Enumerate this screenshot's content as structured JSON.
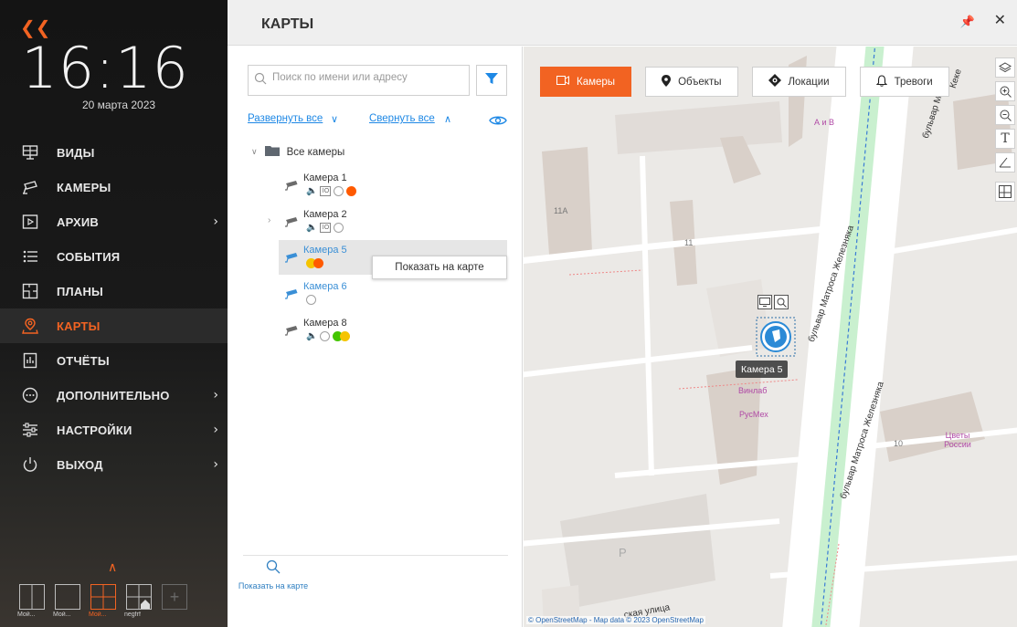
{
  "sidebar": {
    "clock": "16:16",
    "date": "20 марта 2023",
    "nav": [
      {
        "label": "ВИДЫ",
        "icon": "monitor-icon",
        "chevron": false
      },
      {
        "label": "КАМЕРЫ",
        "icon": "camera-icon",
        "chevron": false
      },
      {
        "label": "АРХИВ",
        "icon": "archive-play-icon",
        "chevron": true
      },
      {
        "label": "СОБЫТИЯ",
        "icon": "events-list-icon",
        "chevron": false
      },
      {
        "label": "ПЛАНЫ",
        "icon": "floor-plan-icon",
        "chevron": false
      },
      {
        "label": "КАРТЫ",
        "icon": "map-pin-icon",
        "chevron": false,
        "active": true
      },
      {
        "label": "ОТЧЁТЫ",
        "icon": "report-icon",
        "chevron": false
      },
      {
        "label": "ДОПОЛНИТЕЛЬНО",
        "icon": "more-icon",
        "chevron": true
      },
      {
        "label": "НАСТРОЙКИ",
        "icon": "sliders-icon",
        "chevron": true
      },
      {
        "label": "ВЫХОД",
        "icon": "power-icon",
        "chevron": true
      }
    ],
    "layouts": [
      {
        "label": "Мой..."
      },
      {
        "label": "Мой..."
      },
      {
        "label": "Мой...",
        "active": true
      },
      {
        "label": "negfrf"
      }
    ]
  },
  "header": {
    "title": "КАРТЫ"
  },
  "tree": {
    "search_placeholder": "Поиск по имени или адресу",
    "expand_all": "Развернуть все",
    "collapse_all": "Свернуть все",
    "root_label": "Все камеры",
    "cameras": [
      {
        "name": "Камера 1"
      },
      {
        "name": "Камера 2"
      },
      {
        "name": "Камера 5"
      },
      {
        "name": "Камера 6"
      },
      {
        "name": "Камера 8"
      }
    ],
    "context_tooltip": "Показать на карте",
    "footer_button": "Показать на карте"
  },
  "map": {
    "tabs": [
      {
        "label": "Камеры",
        "icon": "camera-outline-icon",
        "active": true
      },
      {
        "label": "Объекты",
        "icon": "location-pin-icon"
      },
      {
        "label": "Локации",
        "icon": "target-icon"
      },
      {
        "label": "Тревоги",
        "icon": "bell-icon"
      }
    ],
    "camera_pin_label": "Камера 5",
    "attribution": "© OpenStreetMap - Map data © 2023 OpenStreetMap",
    "building_numbers": [
      "11А",
      "11",
      "10"
    ],
    "streets": [
      "бульвар Матроса Железняка",
      "бульвар Матроса Железняка",
      "бульвар М",
      "Кеке",
      "ская улица"
    ],
    "pois": [
      "А и В",
      "Винлаб",
      "РусМех",
      "Цветы России"
    ],
    "parking_label": "P"
  },
  "colors": {
    "accent": "#f26322",
    "link": "#1e88e5",
    "status_orange": "#ff5a00",
    "status_yellow": "#f5c400",
    "status_green": "#43c500"
  }
}
